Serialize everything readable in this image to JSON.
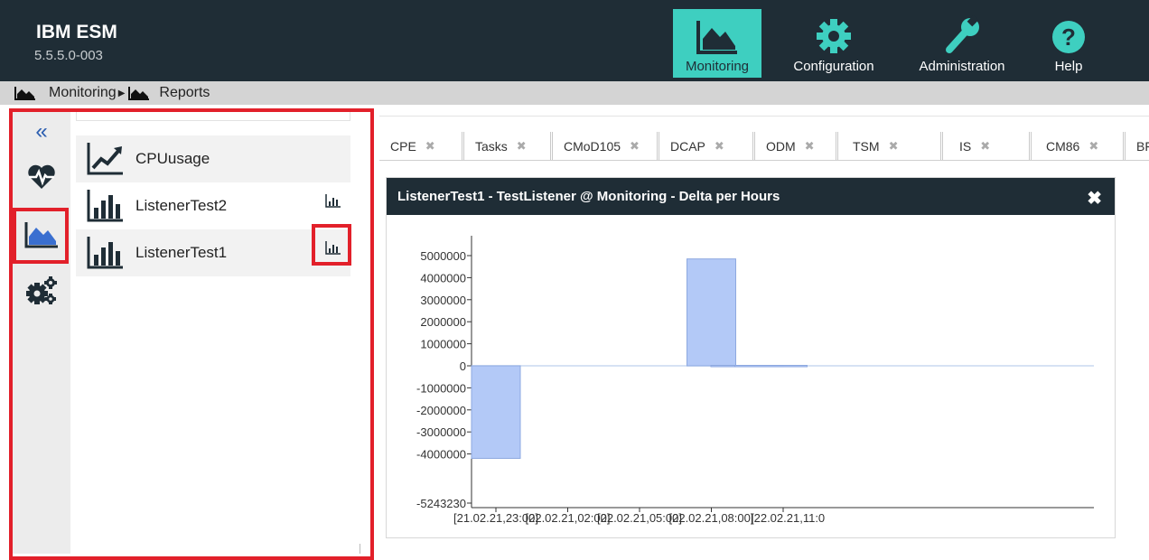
{
  "app": {
    "title": "IBM ESM",
    "version": "5.5.5.0-003"
  },
  "nav": [
    {
      "label": "Monitoring",
      "icon": "area-chart-icon",
      "active": true
    },
    {
      "label": "Configuration",
      "icon": "gear-icon",
      "active": false
    },
    {
      "label": "Administration",
      "icon": "wrench-icon",
      "active": false
    },
    {
      "label": "Help",
      "icon": "question-icon",
      "active": false
    }
  ],
  "breadcrumb": [
    {
      "label": "Monitoring",
      "icon": "area-chart-icon"
    },
    {
      "label": "Reports",
      "icon": "area-chart-icon"
    }
  ],
  "rail": [
    {
      "name": "collapse",
      "icon": "double-chevron-left-icon"
    },
    {
      "name": "health",
      "icon": "heartbeat-icon"
    },
    {
      "name": "reports",
      "icon": "area-chart-icon"
    },
    {
      "name": "settings",
      "icon": "gears-icon"
    }
  ],
  "reports": [
    {
      "label": "CPUusage",
      "icon": "trend-line-icon",
      "has_chart_action": false
    },
    {
      "label": "ListenerTest2",
      "icon": "bar-chart-icon",
      "has_chart_action": true
    },
    {
      "label": "ListenerTest1",
      "icon": "bar-chart-icon",
      "has_chart_action": true
    }
  ],
  "tabs": [
    "CPE",
    "Tasks",
    "CMoD105",
    "DCAP",
    "ODM",
    "TSM",
    "IS",
    "CM86",
    "BF"
  ],
  "tab_close_glyph": "✖",
  "panel": {
    "title": "ListenerTest1 - TestListener @ Monitoring - Delta per Hours",
    "close_glyph": "✖"
  },
  "colors": {
    "header": "#1f2d36",
    "accent": "#3ecfc0",
    "highlight": "#e2202a",
    "bar": "#b3c9f7"
  },
  "chart_data": {
    "type": "bar",
    "title": "",
    "xlabel": "",
    "ylabel": "",
    "ylim": [
      -5243230,
      6000000
    ],
    "y_ticks": [
      "5000000",
      "4000000",
      "3000000",
      "2000000",
      "1000000",
      "0",
      "-1000000",
      "-2000000",
      "-3000000",
      "-4000000",
      "-5243230"
    ],
    "y_tick_values": [
      5000000,
      4000000,
      3000000,
      2000000,
      1000000,
      0,
      -1000000,
      -2000000,
      -3000000,
      -4000000,
      -5243230
    ],
    "x_tick_labels": [
      "[21.02.21,23:00]",
      "[22.02.21,02:00]",
      "[22.02.21,05:00]",
      "[22.02.21,08:00]",
      "[22.02.21,11:0"
    ],
    "bars": [
      {
        "x": "21.02.21 23:00",
        "value": -4200000
      },
      {
        "x": "22.02.21 08:00",
        "value": 4850000
      },
      {
        "x": "22.02.21 09:00",
        "value": 20000
      },
      {
        "x": "22.02.21 10:00",
        "value": 20000
      }
    ]
  }
}
